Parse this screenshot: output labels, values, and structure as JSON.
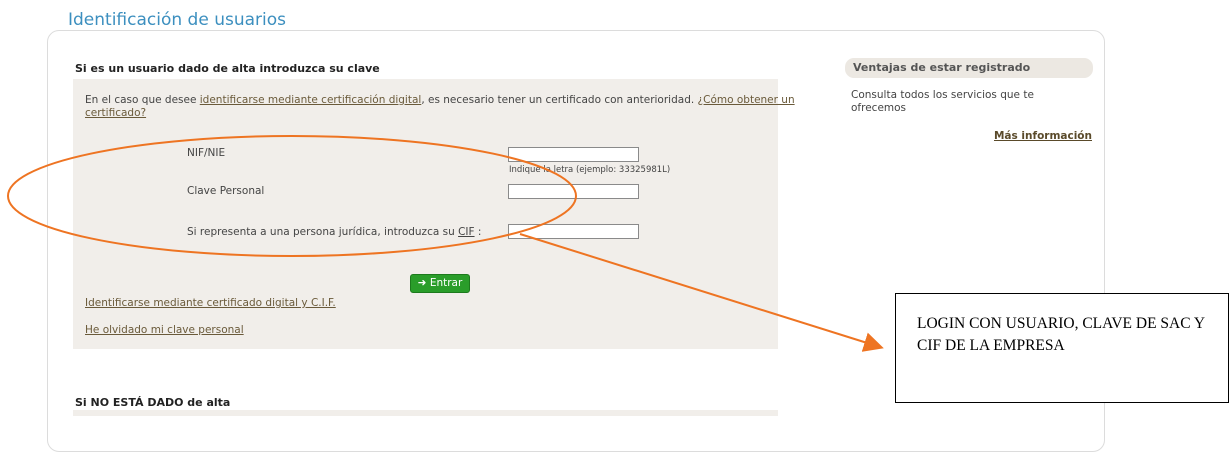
{
  "page": {
    "title": "Identificación de usuarios"
  },
  "login": {
    "section_title": "Si es un usuario dado de alta introduzca su clave",
    "intro_prefix": "En el caso que desee ",
    "intro_link1": "identificarse mediante certificación digital",
    "intro_middle": ", es necesario tener un certificado con anterioridad. ",
    "intro_link2": "¿Cómo obtener un certificado?",
    "nif_label": "NIF/NIE",
    "nif_value": "",
    "nif_hint": "Indique la letra (ejemplo: 33325981L)",
    "clave_label": "Clave Personal",
    "clave_value": "",
    "cif_label_prefix": "Si representa a una persona jurídica, introduzca su ",
    "cif_abbr": "CIF",
    "cif_label_suffix": " :",
    "cif_value": "",
    "submit_label": "Entrar",
    "cert_link": "Identificarse mediante certificado digital y C.I.F.",
    "forgot_link": "He olvidado mi clave personal"
  },
  "register": {
    "section_title": "Si NO ESTÁ DADO de alta"
  },
  "sidebar": {
    "title": "Ventajas de estar registrado",
    "text": "Consulta todos los servicios que te ofrecemos",
    "more_link": "Más información"
  },
  "annotation": {
    "note": "LOGIN CON USUARIO, CLAVE DE SAC Y CIF DE LA EMPRESA",
    "color": "#ee7422"
  },
  "icons": {
    "submit_icon": "arrow-right-icon"
  }
}
